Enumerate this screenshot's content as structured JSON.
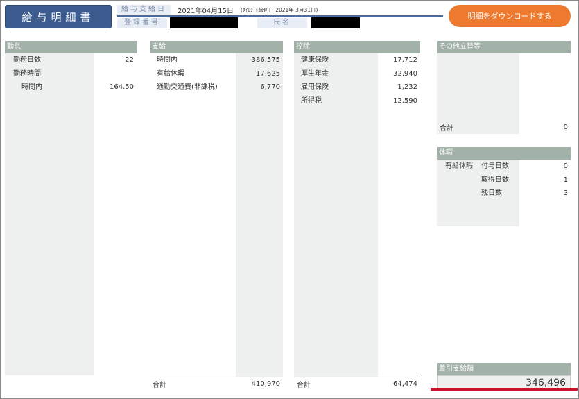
{
  "header": {
    "title": "給与明細書",
    "pay_date_label": "給与支給日",
    "pay_date": "2021年04月15日",
    "cutoff_text": "(ﾀｲﾑｼｰﾄ締切日 2021年 3月31日)",
    "reg_label": "登録番号",
    "name_label": "氏名",
    "download_button": "明細をダウンロードする"
  },
  "attendance": {
    "title": "勤怠",
    "rows": [
      {
        "label": "勤務日数",
        "value": "22"
      },
      {
        "label": "勤務時間",
        "value": ""
      },
      {
        "label": "時間内",
        "value": "164.50"
      }
    ]
  },
  "payment": {
    "title": "支給",
    "rows": [
      {
        "label": "時間内",
        "value": "386,575"
      },
      {
        "label": "有給休暇",
        "value": "17,625"
      },
      {
        "label": "通勤交通費(非課税)",
        "value": "6,770"
      }
    ],
    "total_label": "合計",
    "total_value": "410,970"
  },
  "deduction": {
    "title": "控除",
    "rows": [
      {
        "label": "健康保険",
        "value": "17,712"
      },
      {
        "label": "厚生年金",
        "value": "32,940"
      },
      {
        "label": "雇用保険",
        "value": "1,232"
      },
      {
        "label": "所得税",
        "value": "12,590"
      }
    ],
    "total_label": "合計",
    "total_value": "64,474"
  },
  "other": {
    "title": "その他立替等",
    "total_label": "合計",
    "total_value": "0"
  },
  "leave": {
    "title": "休暇",
    "category": "有給休暇",
    "rows": [
      {
        "label": "付与日数",
        "value": "0"
      },
      {
        "label": "取得日数",
        "value": "1"
      },
      {
        "label": "残日数",
        "value": "3"
      }
    ]
  },
  "net": {
    "title": "差引支給額",
    "value": "346,496"
  },
  "colors": {
    "header_blue": "#3c5b8f",
    "button_orange": "#ee7a30",
    "panel_head": "#a3b2a8",
    "highlight_red": "#d8102a"
  }
}
